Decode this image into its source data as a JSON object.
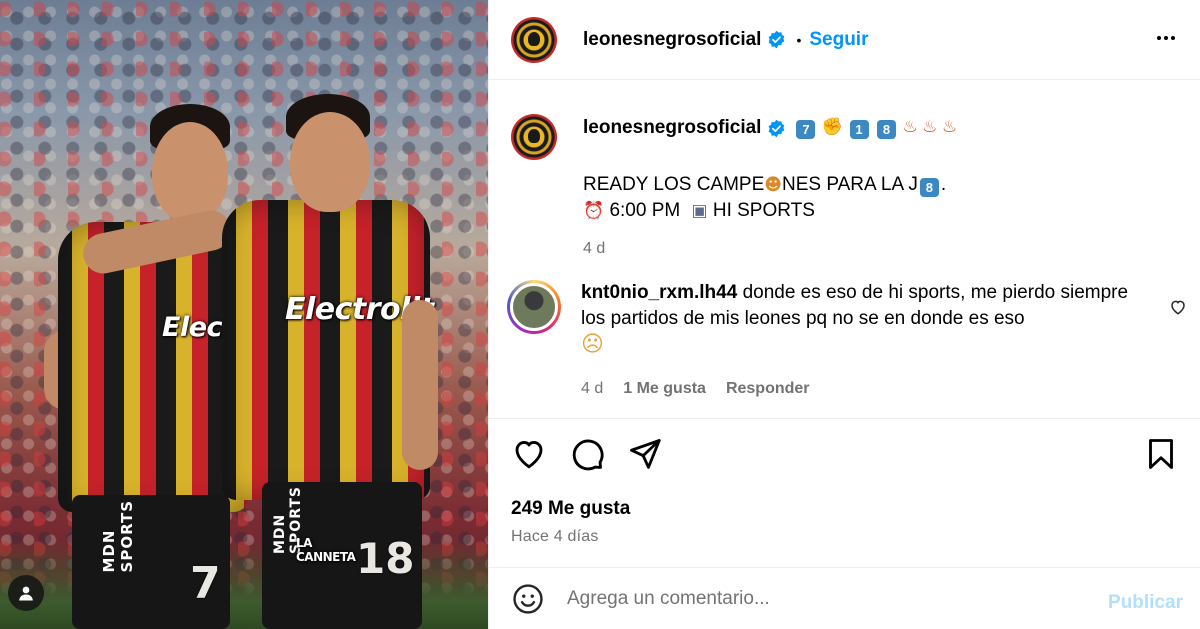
{
  "post": {
    "username": "leonesnegrosoficial",
    "follow_label": "Seguir",
    "dot": "•",
    "more_icon": "more-horizontal-icon"
  },
  "photo": {
    "sponsor_left": "Electrolit",
    "sponsor_right": "Electrolit",
    "number_left": "7",
    "number_right": "18",
    "shorts_sponsor": "MDN SPORTS",
    "shorts_patch": "LA CANNETA",
    "user_tag_icon": "person-icon"
  },
  "caption": {
    "username": "leonesnegrosoficial",
    "emoji_1": "7",
    "emoji_2": "1",
    "emoji_3": "8",
    "line1_a": "READY LOS CAMPE",
    "line1_b": "NES PARA LA J",
    "line1_key": "8",
    "line1_end": ".",
    "line2": "6:00 PM",
    "line2_b": "HI SPORTS",
    "time": "4 d"
  },
  "comment": {
    "username": "knt0nio_rxm.lh44",
    "text": "donde es eso de hi sports, me pierdo siempre los partidos de mis leones pq no se en donde es eso",
    "time": "4 d",
    "likes": "1 Me gusta",
    "reply": "Responder"
  },
  "actions": {
    "likes_count": "249 Me gusta",
    "ago": "Hace 4 días"
  },
  "composer": {
    "placeholder": "Agrega un comentario...",
    "publish": "Publicar"
  },
  "colors": {
    "accent": "#0095f6",
    "publish_disabled": "#b2dffc",
    "secondary_text": "#737373",
    "verified": "#0095f6"
  }
}
